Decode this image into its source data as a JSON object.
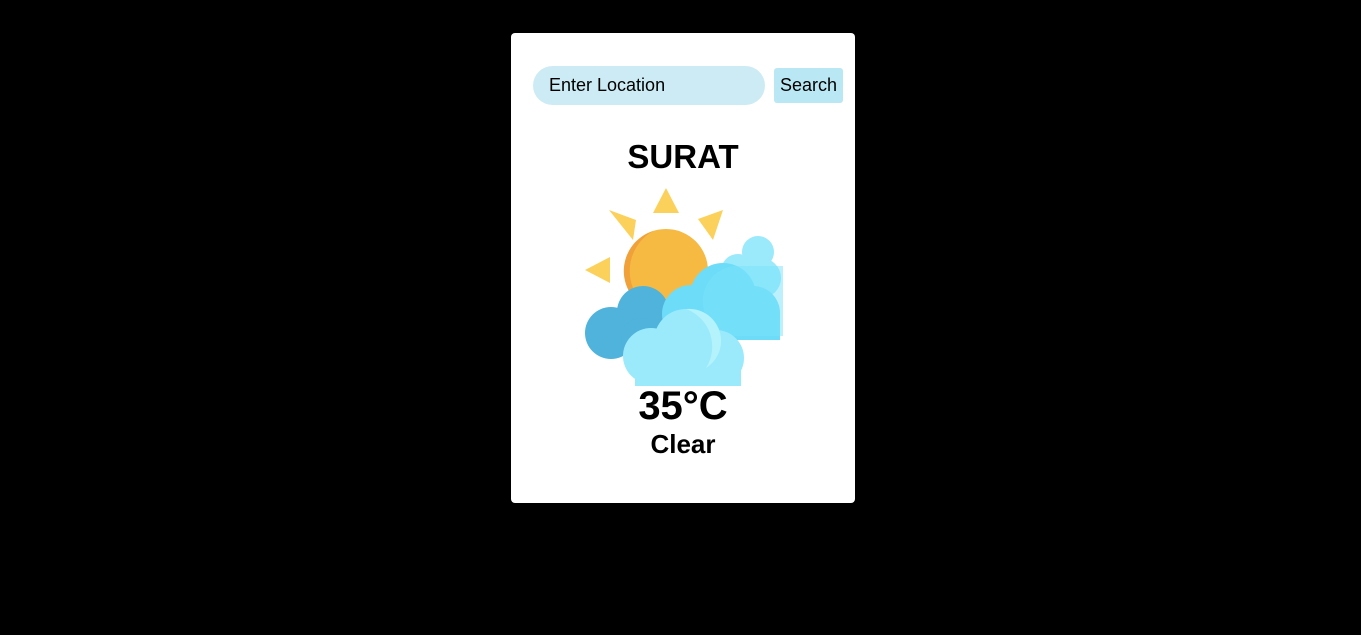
{
  "search": {
    "placeholder": "Enter Location",
    "value": "",
    "button_label": "Search"
  },
  "weather": {
    "city": "SURAT",
    "temperature": "35°C",
    "condition": "Clear",
    "icon": "partly-cloudy-icon"
  },
  "colors": {
    "page_background": "#000000",
    "card_background": "#ffffff",
    "input_background": "#cdebf4",
    "button_background": "#b9e7f4",
    "sun": "#f6b942",
    "sun_rays": "#fbd15b",
    "cloud_dark": "#4fb3dc",
    "cloud_mid": "#6ddcf8",
    "cloud_light": "#9aeafb"
  }
}
